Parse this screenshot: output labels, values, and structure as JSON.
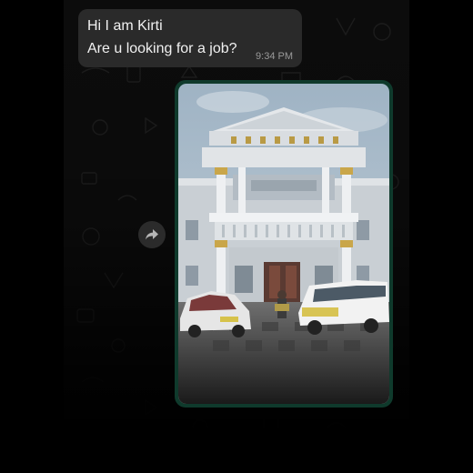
{
  "chat": {
    "incoming_message": {
      "lines": [
        "Hi I am Kirti",
        "Are u looking for a job?"
      ],
      "time": "9:34 PM"
    },
    "forward_button": {
      "icon": "forward-arrow-icon"
    },
    "image_message": {
      "content": "photo"
    }
  },
  "colors": {
    "background": "#000000",
    "incoming_bubble": "#2a2a2a",
    "outgoing_bubble": "#0f3a2c",
    "message_text": "#f1f1f1",
    "timestamp": "#9a9a9a"
  }
}
